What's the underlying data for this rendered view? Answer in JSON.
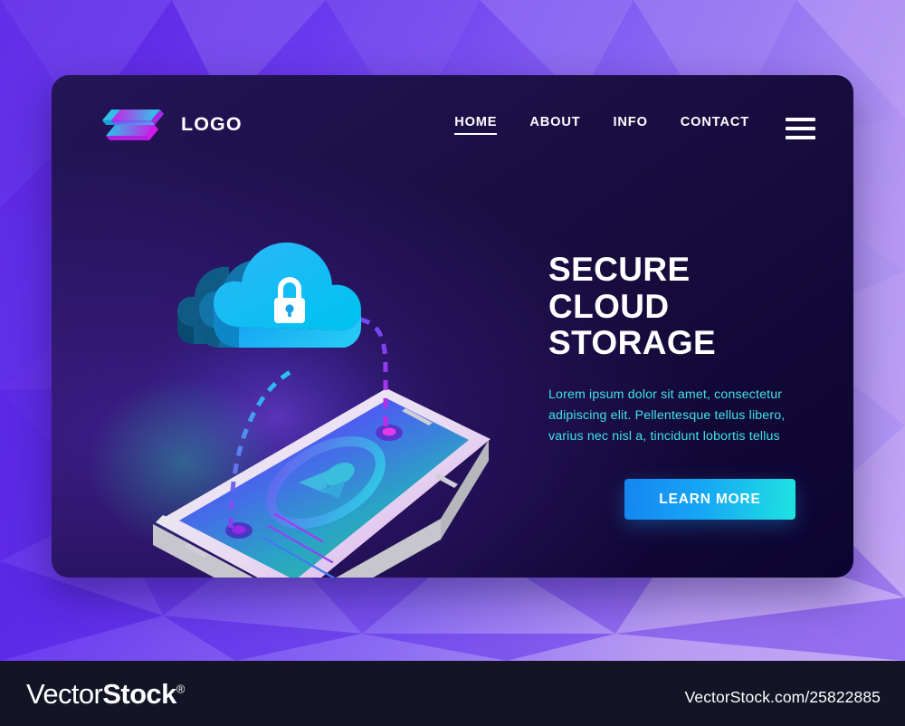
{
  "brand": {
    "name": "LOGO",
    "logo_icon": "isometric-ribbon-logo-icon"
  },
  "nav": {
    "items": [
      {
        "label": "HOME",
        "active": true
      },
      {
        "label": "ABOUT",
        "active": false
      },
      {
        "label": "INFO",
        "active": false
      },
      {
        "label": "CONTACT",
        "active": false
      }
    ],
    "menu_icon": "hamburger-menu-icon"
  },
  "hero": {
    "headline_line1": "SECURE CLOUD",
    "headline_line2": "STORAGE",
    "paragraph": "Lorem ipsum dolor sit amet, consectetur adipiscing elit. Pellentesque tellus libero, varius nec nisl a, tincidunt lobortis tellus",
    "cta_label": "LEARN MORE"
  },
  "illustration": {
    "cloud_icon": "secure-cloud-icon",
    "lock_icon": "padlock-icon",
    "device_icon": "isometric-smartphone-icon",
    "screen_icon": "user-profile-icon",
    "uplink_icon": "dashed-upload-path-icon",
    "downlink_icon": "dashed-download-path-icon"
  },
  "footer": {
    "logo_part1": "Vector",
    "logo_part2": "Stock",
    "registered": "®",
    "url": "VectorStock.com/25822885"
  },
  "colors": {
    "bg_purple_dark": "#5b1fe2",
    "bg_purple_light": "#c3a9f4",
    "card_dark": "#160b3b",
    "accent_cyan": "#3fe3e8",
    "cta_blue": "#1585f2",
    "cta_cyan": "#1fe3e0",
    "cloud_blue": "#12a6f5",
    "footer_bg": "#131426"
  }
}
